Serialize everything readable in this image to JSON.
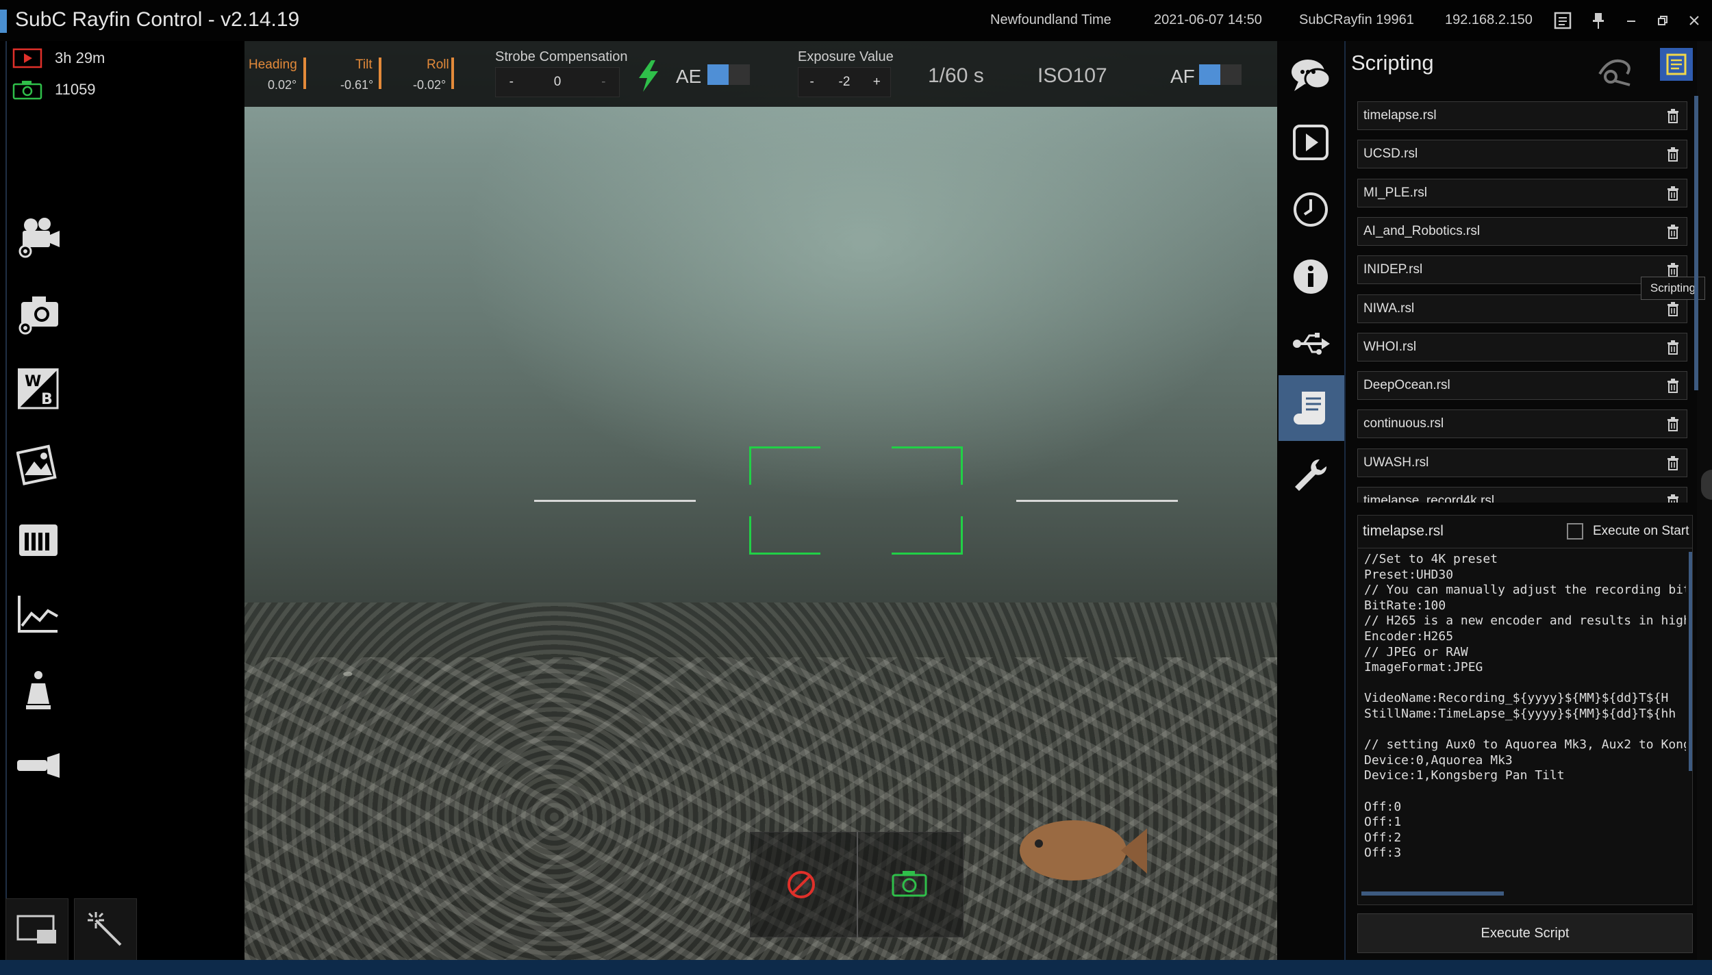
{
  "title_bar": {
    "app_title": "SubC Rayfin Control - v2.14.19",
    "timezone": "Newfoundland Time",
    "datetime": "2021-06-07 14:50",
    "device": "SubCRayfin 19961",
    "ip": "192.168.2.150"
  },
  "status": {
    "record_time": "3h 29m",
    "photo_count": "11059"
  },
  "hud": {
    "heading_label": "Heading",
    "heading_value": "0.02°",
    "tilt_label": "Tilt",
    "tilt_value": "-0.61°",
    "roll_label": "Roll",
    "roll_value": "-0.02°",
    "strobe_label": "Strobe Compensation",
    "strobe_minus": "-",
    "strobe_value": "0",
    "strobe_plus": "-",
    "ae_label": "AE",
    "exposure_label": "Exposure Value",
    "exposure_minus": "-",
    "exposure_value": "-2",
    "exposure_plus": "+",
    "shutter": "1/60 s",
    "iso": "ISO107",
    "af_label": "AF"
  },
  "panel": {
    "title": "Scripting",
    "tooltip": "Scripting",
    "scripts": [
      {
        "name": "timelapse.rsl"
      },
      {
        "name": "UCSD.rsl"
      },
      {
        "name": "MI_PLE.rsl"
      },
      {
        "name": "AI_and_Robotics.rsl"
      },
      {
        "name": "INIDEP.rsl"
      },
      {
        "name": "NIWA.rsl"
      },
      {
        "name": "WHOI.rsl"
      },
      {
        "name": "DeepOcean.rsl"
      },
      {
        "name": "continuous.rsl"
      },
      {
        "name": "UWASH.rsl"
      },
      {
        "name": "timelapse_record4k.rsl"
      }
    ],
    "editor": {
      "file_name": "timelapse.rsl",
      "execute_on_start_label": "Execute on Start",
      "code": "//Set to 4K preset\nPreset:UHD30\n// You can manually adjust the recording bitrate\nBitRate:100\n// H265 is a new encoder and results in higher qu\nEncoder:H265\n// JPEG or RAW\nImageFormat:JPEG\n\nVideoName:Recording_${yyyy}${MM}${dd}T${H\nStillName:TimeLapse_${yyyy}${MM}${dd}T${hh\n\n// setting Aux0 to Aquorea Mk3, Aux2 to Kongsbe\nDevice:0,Aquorea Mk3\nDevice:1,Kongsberg Pan Tilt\n\nOff:0\nOff:1\nOff:2\nOff:3"
    },
    "execute_button": "Execute Script"
  },
  "colors": {
    "accent": "#4f8fd6",
    "hud_orange": "#e38a3a",
    "focus_green": "#21d046",
    "record_red": "#e0302a",
    "photo_green": "#2fbf4a"
  }
}
